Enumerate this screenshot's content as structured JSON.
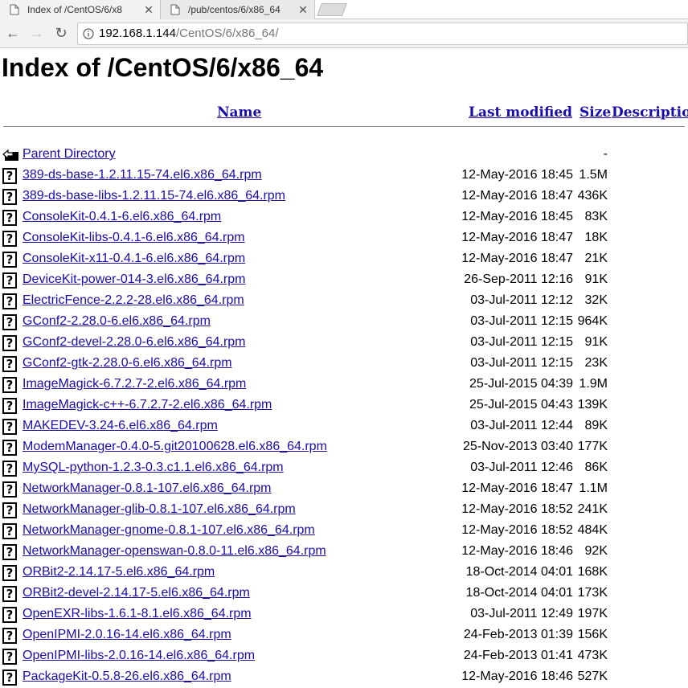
{
  "browser": {
    "tabs": [
      {
        "label": "Index of /CentOS/6/x8"
      },
      {
        "label": "/pub/centos/6/x86_64"
      }
    ],
    "url_host": "192.168.1.144",
    "url_path": "/CentOS/6/x86_64/"
  },
  "page": {
    "title": "Index of /CentOS/6/x86_64",
    "columns": {
      "name": "Name",
      "modified": "Last modified",
      "size": "Size",
      "description": "Description"
    },
    "parent": {
      "label": "Parent Directory",
      "size": "-"
    },
    "files": [
      {
        "name": "389-ds-base-1.2.11.15-74.el6.x86_64.rpm",
        "modified": "12-May-2016 18:45",
        "size": "1.5M"
      },
      {
        "name": "389-ds-base-libs-1.2.11.15-74.el6.x86_64.rpm",
        "modified": "12-May-2016 18:47",
        "size": "436K"
      },
      {
        "name": "ConsoleKit-0.4.1-6.el6.x86_64.rpm",
        "modified": "12-May-2016 18:45",
        "size": "83K"
      },
      {
        "name": "ConsoleKit-libs-0.4.1-6.el6.x86_64.rpm",
        "modified": "12-May-2016 18:47",
        "size": "18K"
      },
      {
        "name": "ConsoleKit-x11-0.4.1-6.el6.x86_64.rpm",
        "modified": "12-May-2016 18:47",
        "size": "21K"
      },
      {
        "name": "DeviceKit-power-014-3.el6.x86_64.rpm",
        "modified": "26-Sep-2011 12:16",
        "size": "91K"
      },
      {
        "name": "ElectricFence-2.2.2-28.el6.x86_64.rpm",
        "modified": "03-Jul-2011 12:12",
        "size": "32K"
      },
      {
        "name": "GConf2-2.28.0-6.el6.x86_64.rpm",
        "modified": "03-Jul-2011 12:15",
        "size": "964K"
      },
      {
        "name": "GConf2-devel-2.28.0-6.el6.x86_64.rpm",
        "modified": "03-Jul-2011 12:15",
        "size": "91K"
      },
      {
        "name": "GConf2-gtk-2.28.0-6.el6.x86_64.rpm",
        "modified": "03-Jul-2011 12:15",
        "size": "23K"
      },
      {
        "name": "ImageMagick-6.7.2.7-2.el6.x86_64.rpm",
        "modified": "25-Jul-2015 04:39",
        "size": "1.9M"
      },
      {
        "name": "ImageMagick-c++-6.7.2.7-2.el6.x86_64.rpm",
        "modified": "25-Jul-2015 04:43",
        "size": "139K"
      },
      {
        "name": "MAKEDEV-3.24-6.el6.x86_64.rpm",
        "modified": "03-Jul-2011 12:44",
        "size": "89K"
      },
      {
        "name": "ModemManager-0.4.0-5.git20100628.el6.x86_64.rpm",
        "modified": "25-Nov-2013 03:40",
        "size": "177K"
      },
      {
        "name": "MySQL-python-1.2.3-0.3.c1.1.el6.x86_64.rpm",
        "modified": "03-Jul-2011 12:46",
        "size": "86K"
      },
      {
        "name": "NetworkManager-0.8.1-107.el6.x86_64.rpm",
        "modified": "12-May-2016 18:47",
        "size": "1.1M"
      },
      {
        "name": "NetworkManager-glib-0.8.1-107.el6.x86_64.rpm",
        "modified": "12-May-2016 18:52",
        "size": "241K"
      },
      {
        "name": "NetworkManager-gnome-0.8.1-107.el6.x86_64.rpm",
        "modified": "12-May-2016 18:52",
        "size": "484K"
      },
      {
        "name": "NetworkManager-openswan-0.8.0-11.el6.x86_64.rpm",
        "modified": "12-May-2016 18:46",
        "size": "92K"
      },
      {
        "name": "ORBit2-2.14.17-5.el6.x86_64.rpm",
        "modified": "18-Oct-2014 04:01",
        "size": "168K"
      },
      {
        "name": "ORBit2-devel-2.14.17-5.el6.x86_64.rpm",
        "modified": "18-Oct-2014 04:01",
        "size": "173K"
      },
      {
        "name": "OpenEXR-libs-1.6.1-8.1.el6.x86_64.rpm",
        "modified": "03-Jul-2011 12:49",
        "size": "197K"
      },
      {
        "name": "OpenIPMI-2.0.16-14.el6.x86_64.rpm",
        "modified": "24-Feb-2013 01:39",
        "size": "156K"
      },
      {
        "name": "OpenIPMI-libs-2.0.16-14.el6.x86_64.rpm",
        "modified": "24-Feb-2013 01:41",
        "size": "473K"
      },
      {
        "name": "PackageKit-0.5.8-26.el6.x86_64.rpm",
        "modified": "12-May-2016 18:46",
        "size": "527K"
      }
    ]
  }
}
